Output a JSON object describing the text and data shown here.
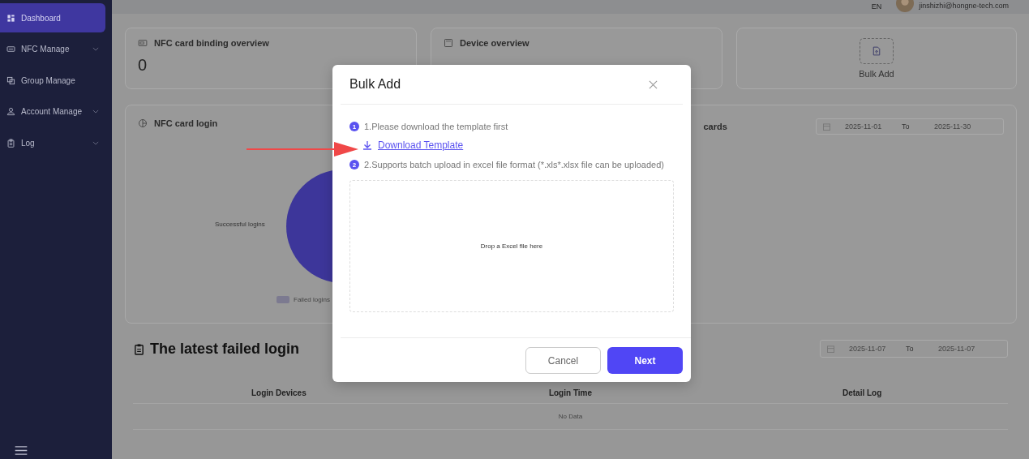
{
  "sidebar": {
    "items": [
      {
        "label": "Dashboard",
        "kind": "link",
        "selected": true
      },
      {
        "label": "NFC Manage",
        "kind": "group",
        "selected": false
      },
      {
        "label": "Group Manage",
        "kind": "link",
        "selected": false
      },
      {
        "label": "Account Manage",
        "kind": "group",
        "selected": false
      },
      {
        "label": "Log",
        "kind": "group",
        "selected": false
      }
    ]
  },
  "header": {
    "language": "EN",
    "email": "jinshizhi@hongne-tech.com"
  },
  "overview": {
    "binding_title": "NFC card binding overview",
    "binding_value": "0",
    "device_title": "Device overview",
    "bulk_add": "Bulk Add"
  },
  "login_card": {
    "title": "NFC card login",
    "success_label": "Successful logins",
    "failed_label": "Failed logins"
  },
  "cards_card": {
    "title": "cards",
    "range": {
      "start": "2025-11-01",
      "separator": "To",
      "end": "2025-11-30"
    }
  },
  "failed": {
    "title": "The latest failed login",
    "range": {
      "start": "2025-11-07",
      "separator": "To",
      "end": "2025-11-07"
    },
    "columns": [
      "Login Devices",
      "Login Time",
      "Detail Log"
    ],
    "empty": "No Data"
  },
  "dialog": {
    "title": "Bulk Add",
    "steps": [
      {
        "number": "1",
        "text": "1.Please download the template first"
      },
      {
        "number": "2",
        "text": "2.Supports batch upload in excel file format (*.xls*.xlsx file can be uploaded)"
      }
    ],
    "link": "Download Template",
    "dropzone": "Drop a Excel file here",
    "cancel": "Cancel",
    "next": "Next"
  }
}
